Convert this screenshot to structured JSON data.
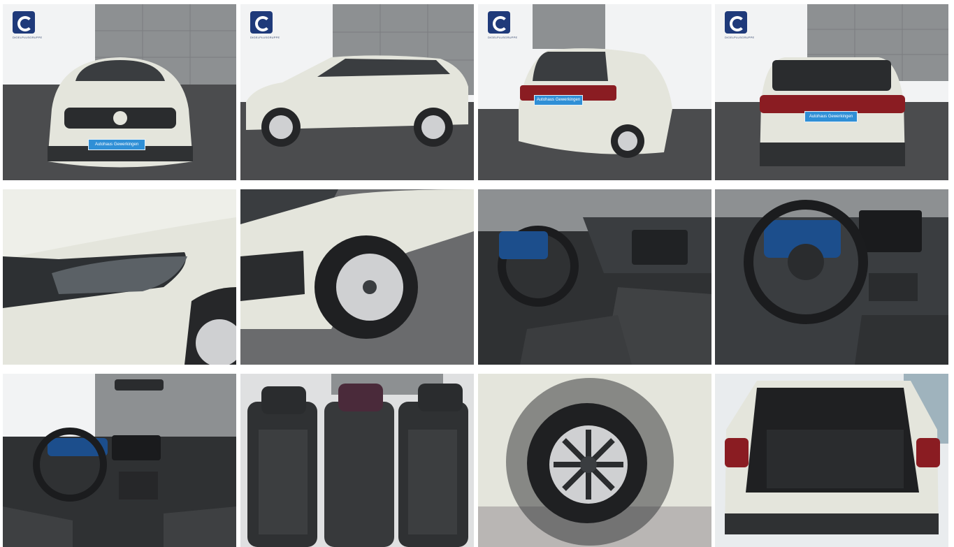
{
  "logo": {
    "subtext": "DIGELPLUSGRUPPE"
  },
  "plate": {
    "text": "Autohaus Gewerkingen"
  },
  "photos": [
    {
      "subject": "front exterior"
    },
    {
      "subject": "side exterior"
    },
    {
      "subject": "rear three-quarter exterior"
    },
    {
      "subject": "rear exterior"
    },
    {
      "subject": "headlight detail"
    },
    {
      "subject": "front wheel detail"
    },
    {
      "subject": "driver cockpit"
    },
    {
      "subject": "steering wheel and dashboard"
    },
    {
      "subject": "dashboard overview"
    },
    {
      "subject": "rear seats"
    },
    {
      "subject": "alloy wheel"
    },
    {
      "subject": "open trunk"
    }
  ],
  "colors": {
    "body": "#e4e5dc",
    "showroom_wall": "#8d9092",
    "floor": "#4b4c4e",
    "interior": "#2f3133",
    "brand_blue": "#1f3a7a",
    "plate_blue": "#2f8fd6"
  }
}
